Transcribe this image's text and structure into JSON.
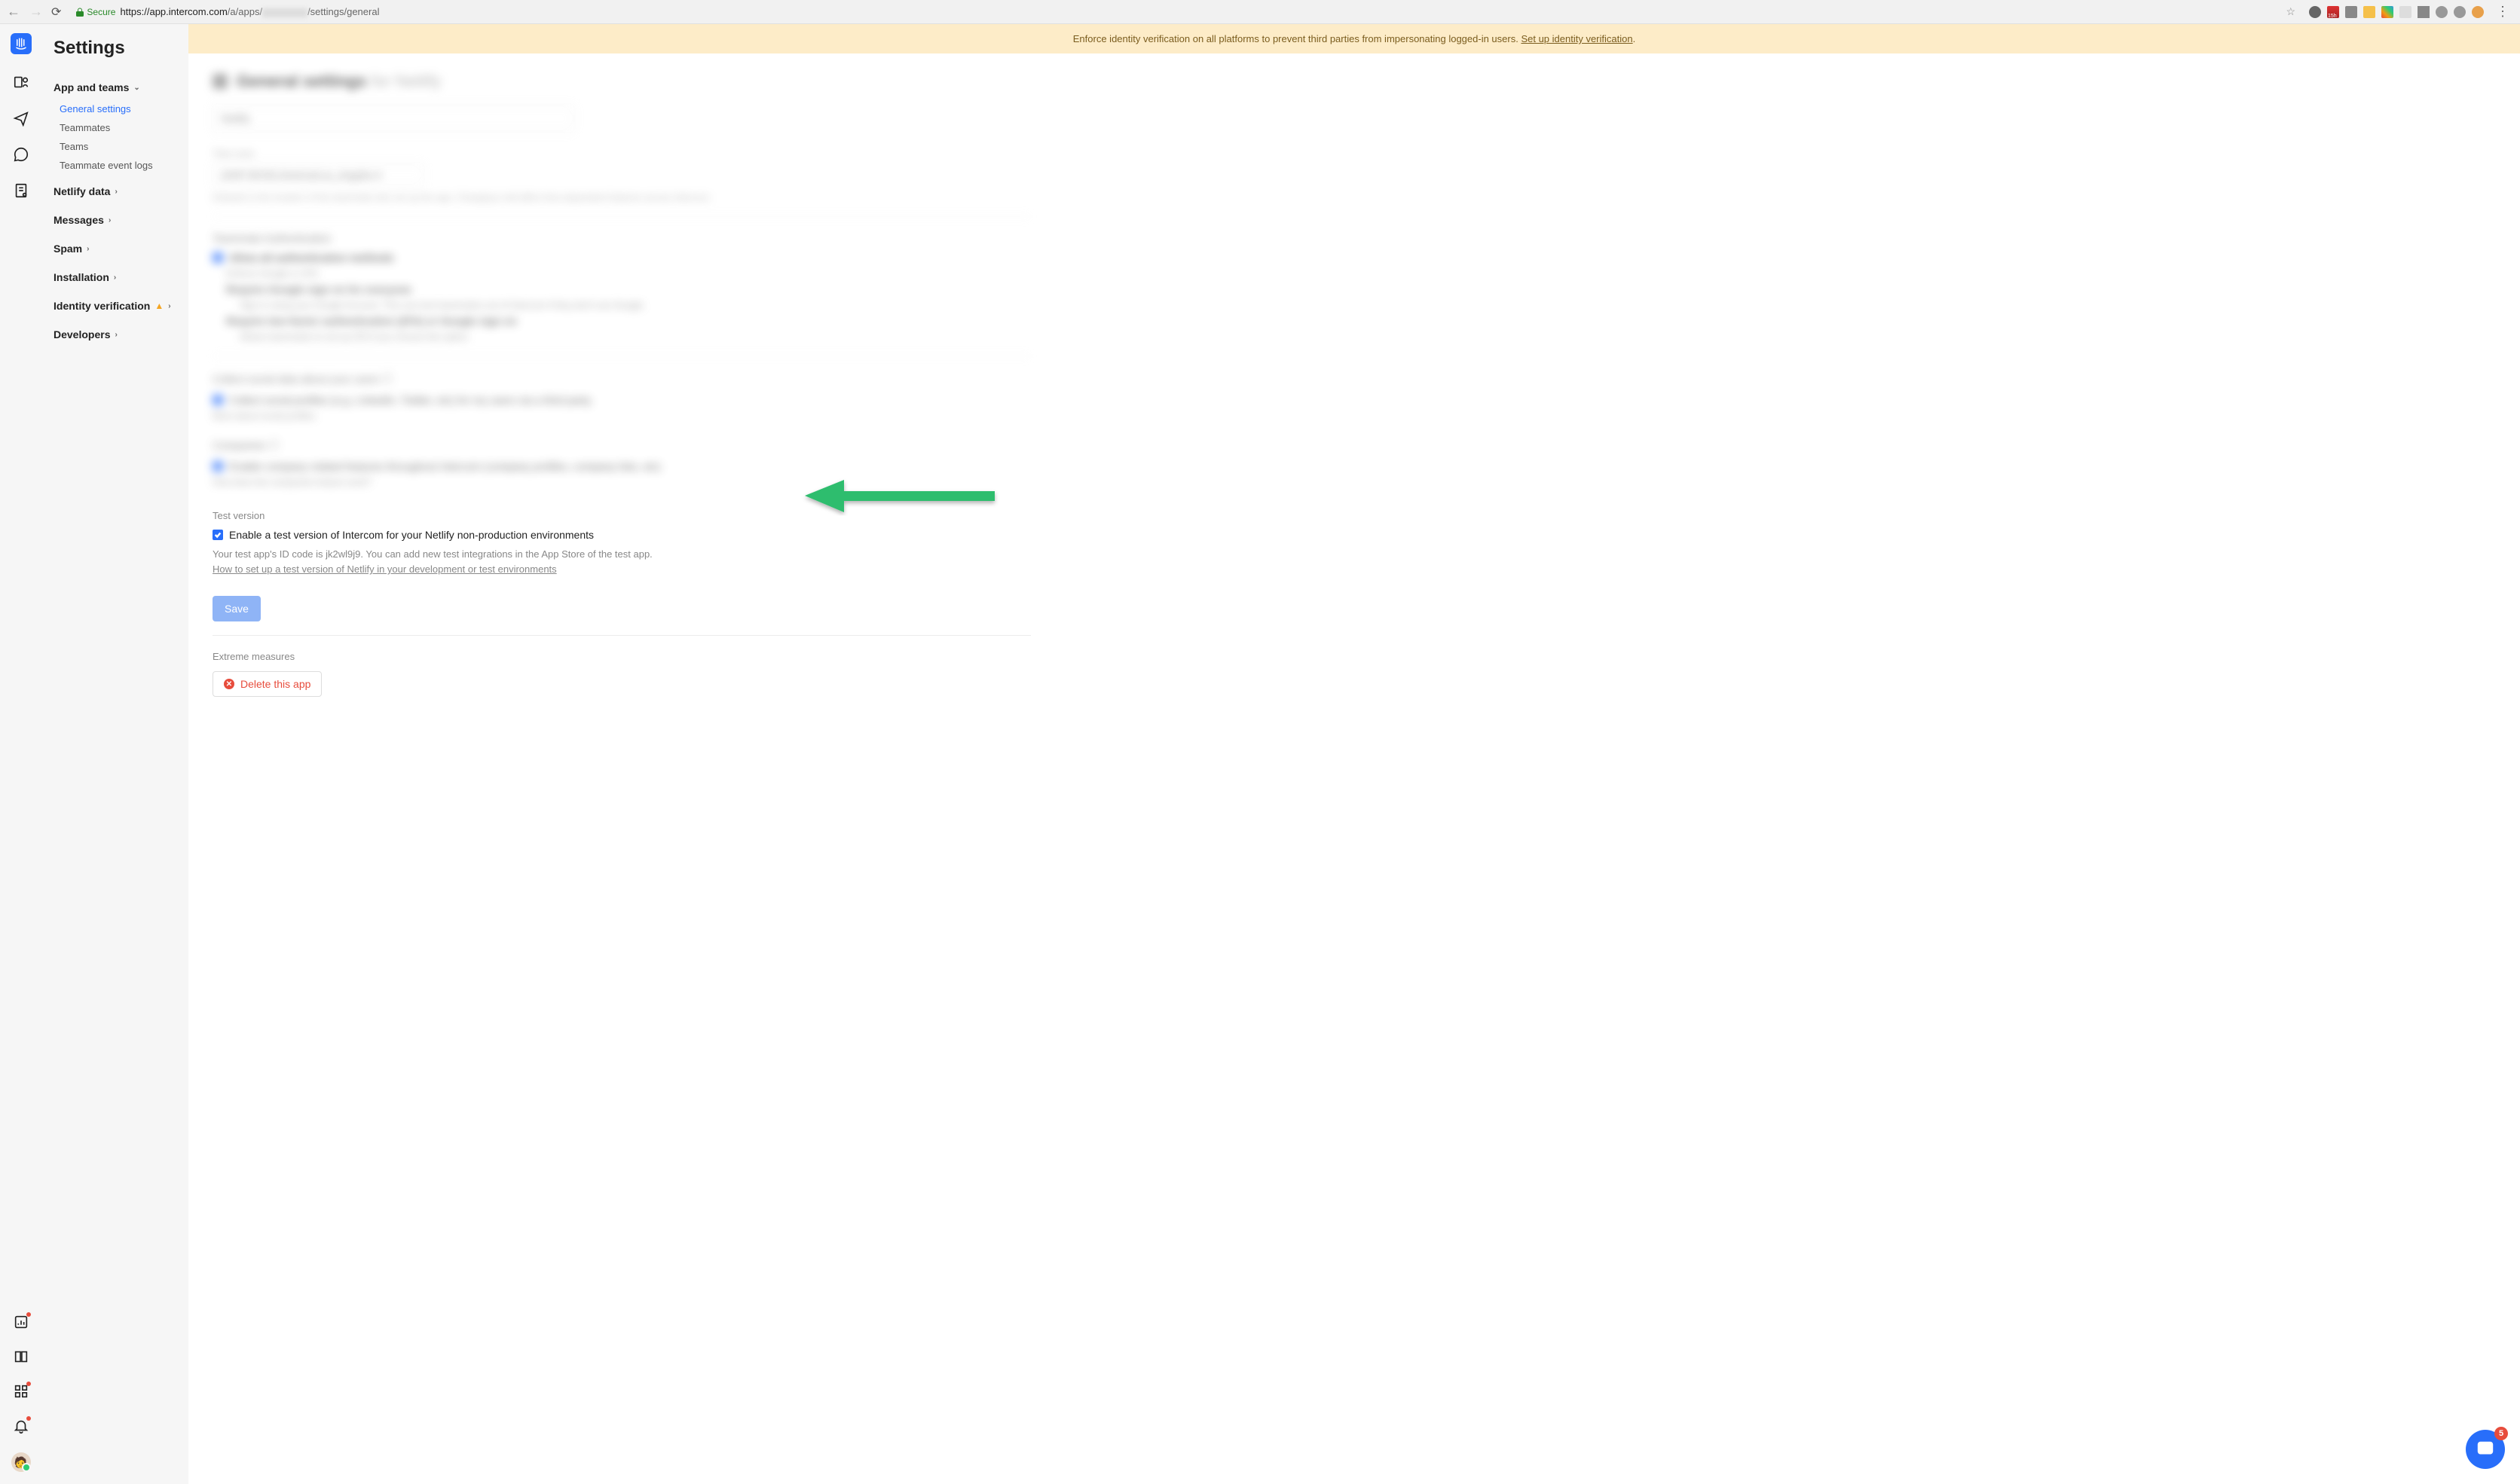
{
  "browser": {
    "secure_label": "Secure",
    "url_prefix": "https://",
    "url_domain": "app.intercom.com",
    "url_path_prefix": "/a/apps/",
    "url_path_suffix": "/settings/general"
  },
  "banner": {
    "text": "Enforce identity verification on all platforms to prevent third parties from impersonating logged-in users. ",
    "link": "Set up identity verification",
    "period": "."
  },
  "sidebar": {
    "title": "Settings",
    "groups": [
      {
        "label": "App and teams",
        "expanded": true,
        "items": [
          "General settings",
          "Teammates",
          "Teams",
          "Teammate event logs"
        ],
        "active_index": 0
      },
      {
        "label": "Netlify data",
        "expanded": false
      },
      {
        "label": "Messages",
        "expanded": false
      },
      {
        "label": "Spam",
        "expanded": false
      },
      {
        "label": "Installation",
        "expanded": false
      },
      {
        "label": "Identity verification",
        "expanded": false,
        "warning": true
      },
      {
        "label": "Developers",
        "expanded": false
      }
    ]
  },
  "test_version": {
    "section_label": "Test version",
    "checkbox_label": "Enable a test version of Intercom for your Netlify non-production environments",
    "help_prefix": "Your test app's ID code is ",
    "app_id": "jk2wl9j9",
    "help_suffix": ". You can add new test integrations in the App Store of the test app.",
    "help_link": "How to set up a test version of Netlify in your development or test environments"
  },
  "buttons": {
    "save": "Save",
    "delete": "Delete this app"
  },
  "extreme": {
    "label": "Extreme measures"
  },
  "widget": {
    "badge": "5"
  }
}
